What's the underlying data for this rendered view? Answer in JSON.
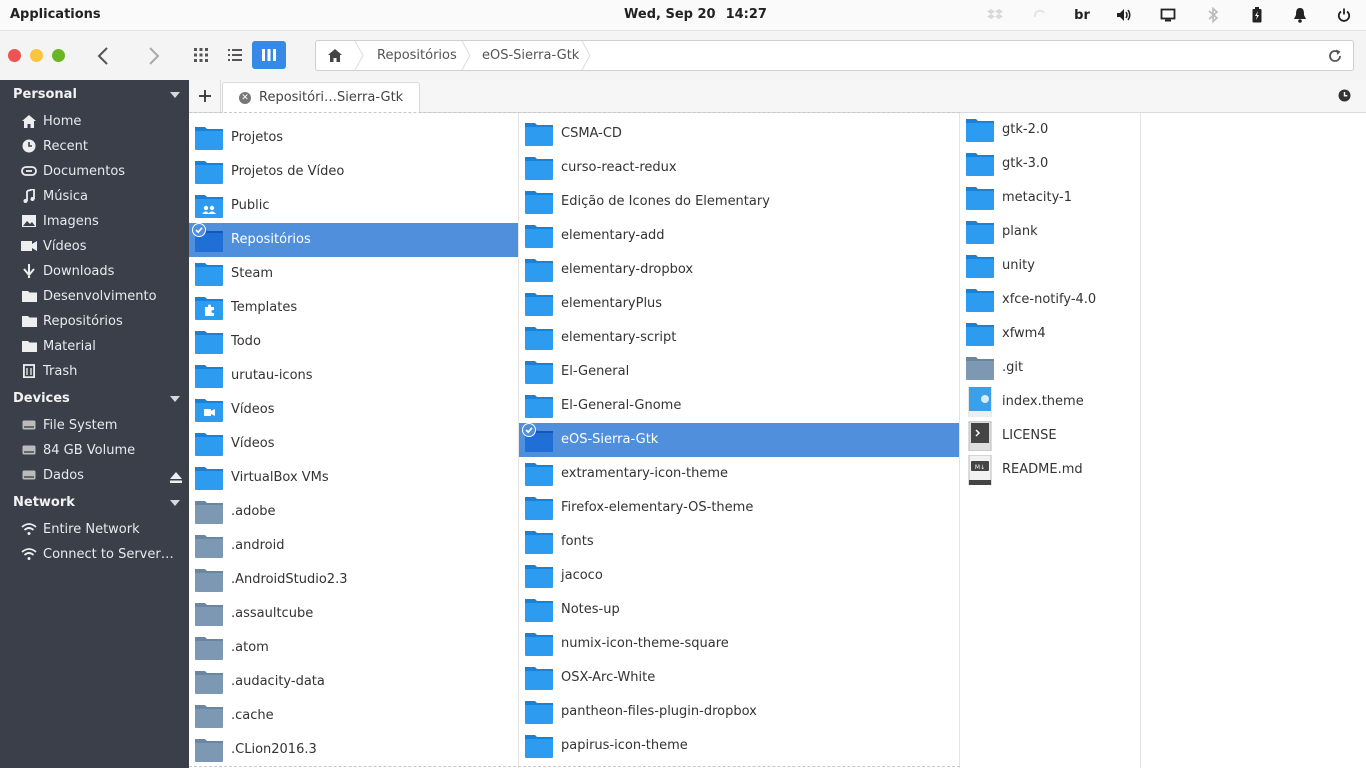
{
  "panel": {
    "applications_label": "Applications",
    "date": "Wed, Sep 20",
    "time": "14:27",
    "keyboard_layout": "br"
  },
  "header": {
    "path": [
      "Repositórios",
      "eOS-Sierra-Gtk"
    ]
  },
  "sidebar": {
    "sections": [
      {
        "title": "Personal",
        "items": [
          {
            "label": "Home",
            "icon": "home-icon"
          },
          {
            "label": "Recent",
            "icon": "clock-icon"
          },
          {
            "label": "Documentos",
            "icon": "link-icon"
          },
          {
            "label": "Música",
            "icon": "music-icon"
          },
          {
            "label": "Imagens",
            "icon": "image-icon"
          },
          {
            "label": "Vídeos",
            "icon": "video-icon"
          },
          {
            "label": "Downloads",
            "icon": "download-icon"
          },
          {
            "label": "Desenvolvimento",
            "icon": "folder-icon"
          },
          {
            "label": "Repositórios",
            "icon": "folder-icon"
          },
          {
            "label": "Material",
            "icon": "folder-icon"
          },
          {
            "label": "Trash",
            "icon": "trash-icon"
          }
        ]
      },
      {
        "title": "Devices",
        "items": [
          {
            "label": "File System",
            "icon": "drive-icon"
          },
          {
            "label": "84 GB Volume",
            "icon": "drive-icon"
          },
          {
            "label": "Dados",
            "icon": "drive-icon"
          }
        ]
      },
      {
        "title": "Network",
        "items": [
          {
            "label": "Entire Network",
            "icon": "network-icon"
          },
          {
            "label": "Connect to Server…",
            "icon": "network-icon"
          }
        ]
      }
    ]
  },
  "tabs": [
    {
      "label": "Repositóri…Sierra-Gtk"
    }
  ],
  "columns": {
    "col1": [
      {
        "name": "Projetos",
        "kind": "folder"
      },
      {
        "name": "Projetos de Vídeo",
        "kind": "folder"
      },
      {
        "name": "Public",
        "kind": "folder-public"
      },
      {
        "name": "Repositórios",
        "kind": "folder",
        "selected": true
      },
      {
        "name": "Steam",
        "kind": "folder"
      },
      {
        "name": "Templates",
        "kind": "folder-templates"
      },
      {
        "name": "Todo",
        "kind": "folder"
      },
      {
        "name": "urutau-icons",
        "kind": "folder"
      },
      {
        "name": "Vídeos",
        "kind": "folder-videos"
      },
      {
        "name": "Vídeos",
        "kind": "folder"
      },
      {
        "name": "VirtualBox VMs",
        "kind": "folder"
      },
      {
        "name": ".adobe",
        "kind": "folder-hidden"
      },
      {
        "name": ".android",
        "kind": "folder-hidden"
      },
      {
        "name": ".AndroidStudio2.3",
        "kind": "folder-hidden"
      },
      {
        "name": ".assaultcube",
        "kind": "folder-hidden"
      },
      {
        "name": ".atom",
        "kind": "folder-hidden"
      },
      {
        "name": ".audacity-data",
        "kind": "folder-hidden"
      },
      {
        "name": ".cache",
        "kind": "folder-hidden"
      },
      {
        "name": ".CLion2016.3",
        "kind": "folder-hidden"
      }
    ],
    "col2": [
      {
        "name": "CSMA-CD",
        "kind": "folder"
      },
      {
        "name": "curso-react-redux",
        "kind": "folder"
      },
      {
        "name": "Edição de Icones do Elementary",
        "kind": "folder"
      },
      {
        "name": "elementary-add",
        "kind": "folder"
      },
      {
        "name": "elementary-dropbox",
        "kind": "folder"
      },
      {
        "name": "elementaryPlus",
        "kind": "folder"
      },
      {
        "name": "elementary-script",
        "kind": "folder"
      },
      {
        "name": "El-General",
        "kind": "folder"
      },
      {
        "name": "El-General-Gnome",
        "kind": "folder"
      },
      {
        "name": "eOS-Sierra-Gtk",
        "kind": "folder",
        "selected": true
      },
      {
        "name": "extramentary-icon-theme",
        "kind": "folder"
      },
      {
        "name": "Firefox-elementary-OS-theme",
        "kind": "folder"
      },
      {
        "name": "fonts",
        "kind": "folder"
      },
      {
        "name": "jacoco",
        "kind": "folder"
      },
      {
        "name": "Notes-up",
        "kind": "folder"
      },
      {
        "name": "numix-icon-theme-square",
        "kind": "folder"
      },
      {
        "name": "OSX-Arc-White",
        "kind": "folder"
      },
      {
        "name": "pantheon-files-plugin-dropbox",
        "kind": "folder"
      },
      {
        "name": "papirus-icon-theme",
        "kind": "folder"
      }
    ],
    "col3": [
      {
        "name": "gtk-2.0",
        "kind": "folder"
      },
      {
        "name": "gtk-3.0",
        "kind": "folder"
      },
      {
        "name": "metacity-1",
        "kind": "folder"
      },
      {
        "name": "plank",
        "kind": "folder"
      },
      {
        "name": "unity",
        "kind": "folder"
      },
      {
        "name": "xfce-notify-4.0",
        "kind": "folder"
      },
      {
        "name": "xfwm4",
        "kind": "folder"
      },
      {
        "name": ".git",
        "kind": "folder-hidden"
      },
      {
        "name": "index.theme",
        "kind": "file-theme"
      },
      {
        "name": "LICENSE",
        "kind": "file-script"
      },
      {
        "name": "README.md",
        "kind": "file-markdown"
      }
    ]
  },
  "colors": {
    "accent": "#3689e6",
    "selection": "#4f8fdc",
    "folder_blue": "#2d9cf0",
    "folder_hidden": "#7c98b3",
    "sidebar_bg": "#3a3f49",
    "close": "#ed5353",
    "minimize": "#f9c440",
    "maximize": "#68b723"
  }
}
